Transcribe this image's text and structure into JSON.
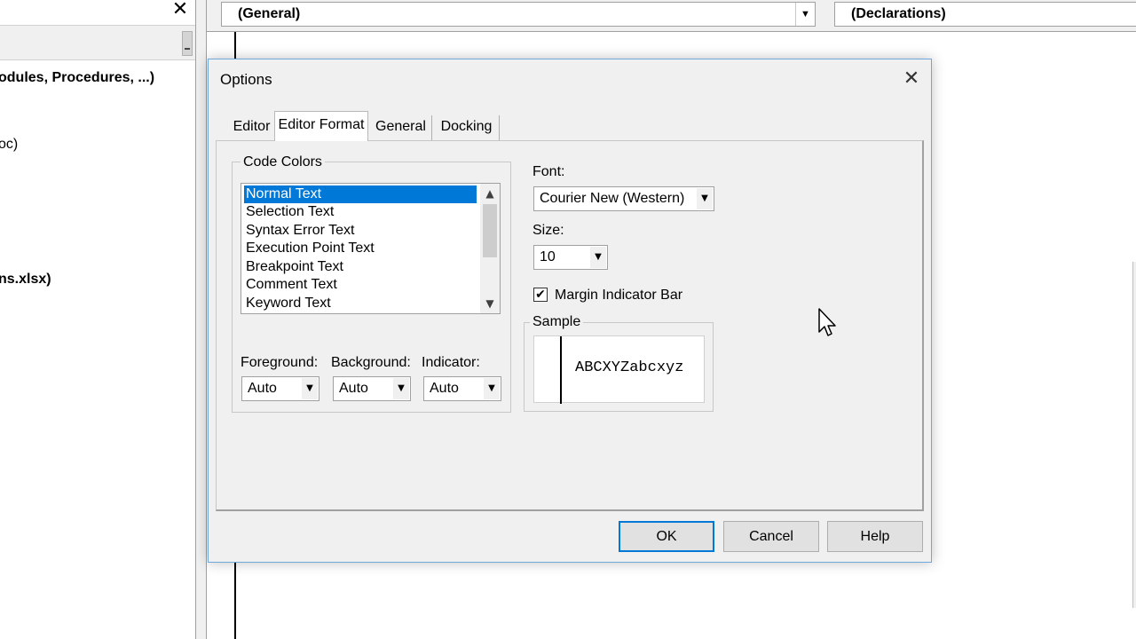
{
  "project_pane": {
    "close_glyph": "✕",
    "tree_items": [
      {
        "label": "odules, Procedures, ...)",
        "bold": true
      },
      {
        "label": "oc)",
        "bold": false
      },
      {
        "label": "ns.xlsx)",
        "bold": true
      }
    ]
  },
  "code_window": {
    "object_combo": "(General)",
    "procedure_combo": "(Declarations)",
    "combo_arrow": "▼"
  },
  "dialog": {
    "title": "Options",
    "close_glyph": "✕",
    "tabs": [
      {
        "label": "Editor",
        "active": false
      },
      {
        "label": "Editor Format",
        "active": true
      },
      {
        "label": "General",
        "active": false
      },
      {
        "label": "Docking",
        "active": false
      }
    ],
    "code_colors": {
      "legend": "Code Colors",
      "items": [
        "Normal Text",
        "Selection Text",
        "Syntax Error Text",
        "Execution Point Text",
        "Breakpoint Text",
        "Comment Text",
        "Keyword Text"
      ],
      "selected_index": 0,
      "scroll_up_glyph": "▲",
      "scroll_down_glyph": "▼"
    },
    "foreground": {
      "label": "Foreground:",
      "value": "Auto"
    },
    "background": {
      "label": "Background:",
      "value": "Auto"
    },
    "indicator": {
      "label": "Indicator:",
      "value": "Auto"
    },
    "font": {
      "label": "Font:",
      "value": "Courier New (Western)"
    },
    "size": {
      "label": "Size:",
      "value": "10"
    },
    "margin_indicator_bar": {
      "label": "Margin Indicator Bar",
      "checked": true,
      "check_glyph": "✔"
    },
    "sample": {
      "legend": "Sample",
      "text": "ABCXYZabcxyz"
    },
    "dropdown_glyph": "▼",
    "buttons": {
      "ok": "OK",
      "cancel": "Cancel",
      "help": "Help"
    }
  },
  "colors": {
    "selection": "#0078d7",
    "dialog_bg": "#f0f0f0",
    "dialog_border": "#6fa8dc"
  }
}
